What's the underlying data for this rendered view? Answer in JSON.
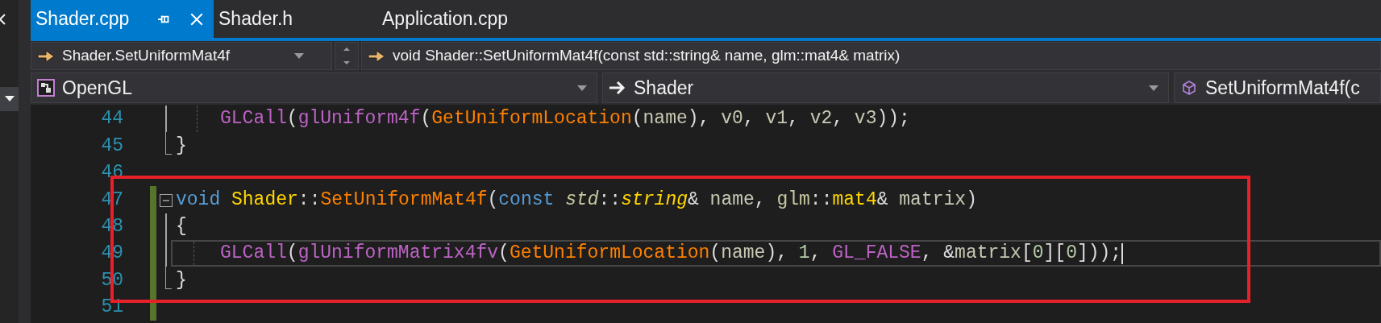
{
  "tabs": [
    {
      "label": "Shader.cpp",
      "selected": true
    },
    {
      "label": "Shader.h",
      "selected": false
    },
    {
      "label": "Application.cpp",
      "selected": false
    }
  ],
  "navigation_bar": {
    "member": "Shader.SetUniformMat4f",
    "signature": "void Shader::SetUniformMat4f(const std::string& name, glm::mat4& matrix)"
  },
  "scope_bar": {
    "project": "OpenGL",
    "class": "Shader",
    "member": "SetUniformMat4f(c"
  },
  "editor": {
    "lines": [
      {
        "number": "44",
        "changed": false,
        "fold_line": true,
        "fold_end": false,
        "fold_button": false,
        "indented": true,
        "current": false,
        "tokens": [
          {
            "text": "GLCall",
            "kind": "macro"
          },
          {
            "text": "(",
            "kind": "plain"
          },
          {
            "text": "glUniform4f",
            "kind": "macro"
          },
          {
            "text": "(",
            "kind": "plain"
          },
          {
            "text": "GetUniformLocation",
            "kind": "function"
          },
          {
            "text": "(",
            "kind": "plain"
          },
          {
            "text": "name",
            "kind": "parameter"
          },
          {
            "text": "), ",
            "kind": "plain"
          },
          {
            "text": "v0",
            "kind": "parameter"
          },
          {
            "text": ", ",
            "kind": "plain"
          },
          {
            "text": "v1",
            "kind": "parameter"
          },
          {
            "text": ", ",
            "kind": "plain"
          },
          {
            "text": "v2",
            "kind": "parameter"
          },
          {
            "text": ", ",
            "kind": "plain"
          },
          {
            "text": "v3",
            "kind": "parameter"
          },
          {
            "text": "));",
            "kind": "plain"
          }
        ]
      },
      {
        "number": "45",
        "changed": false,
        "fold_line": false,
        "fold_end": true,
        "fold_button": false,
        "indented": false,
        "current": false,
        "tokens": [
          {
            "text": "}",
            "kind": "plain"
          }
        ]
      },
      {
        "number": "46",
        "changed": false,
        "fold_line": false,
        "fold_end": false,
        "fold_button": false,
        "indented": false,
        "current": false
      },
      {
        "number": "47",
        "changed": true,
        "fold_line": false,
        "fold_end": false,
        "fold_button": true,
        "indented": false,
        "current": false,
        "tokens": [
          {
            "text": "void ",
            "kind": "keyword"
          },
          {
            "text": "Shader",
            "kind": "class"
          },
          {
            "text": "::",
            "kind": "plain"
          },
          {
            "text": "SetUniformMat4f",
            "kind": "function"
          },
          {
            "text": "(",
            "kind": "plain"
          },
          {
            "text": "const ",
            "kind": "keyword"
          },
          {
            "text": "std",
            "kind": "namespace_italic"
          },
          {
            "text": "::",
            "kind": "plain"
          },
          {
            "text": "string",
            "kind": "class_italic"
          },
          {
            "text": "& ",
            "kind": "plain"
          },
          {
            "text": "name",
            "kind": "parameter"
          },
          {
            "text": ", ",
            "kind": "plain"
          },
          {
            "text": "glm",
            "kind": "namespace"
          },
          {
            "text": "::",
            "kind": "plain"
          },
          {
            "text": "mat4",
            "kind": "class"
          },
          {
            "text": "& ",
            "kind": "plain"
          },
          {
            "text": "matrix",
            "kind": "parameter"
          },
          {
            "text": ")",
            "kind": "plain"
          }
        ]
      },
      {
        "number": "48",
        "changed": true,
        "fold_line": true,
        "fold_end": false,
        "fold_button": false,
        "indented": false,
        "current": false,
        "tokens": [
          {
            "text": "{",
            "kind": "plain"
          }
        ]
      },
      {
        "number": "49",
        "changed": true,
        "fold_line": true,
        "fold_end": false,
        "fold_button": false,
        "indented": true,
        "current": true,
        "tokens": [
          {
            "text": "GLCall",
            "kind": "macro"
          },
          {
            "text": "(",
            "kind": "plain"
          },
          {
            "text": "glUniformMatrix4fv",
            "kind": "macro"
          },
          {
            "text": "(",
            "kind": "plain"
          },
          {
            "text": "GetUniformLocation",
            "kind": "function"
          },
          {
            "text": "(",
            "kind": "plain"
          },
          {
            "text": "name",
            "kind": "parameter"
          },
          {
            "text": "), ",
            "kind": "plain"
          },
          {
            "text": "1",
            "kind": "number"
          },
          {
            "text": ", ",
            "kind": "plain"
          },
          {
            "text": "GL_FALSE",
            "kind": "macro"
          },
          {
            "text": ", &",
            "kind": "plain"
          },
          {
            "text": "matrix",
            "kind": "parameter"
          },
          {
            "text": "[",
            "kind": "plain"
          },
          {
            "text": "0",
            "kind": "number"
          },
          {
            "text": "][",
            "kind": "plain"
          },
          {
            "text": "0",
            "kind": "number"
          },
          {
            "text": "]));",
            "kind": "plain"
          }
        ]
      },
      {
        "number": "50",
        "changed": true,
        "fold_line": false,
        "fold_end": true,
        "fold_button": false,
        "indented": false,
        "current": false,
        "tokens": [
          {
            "text": "}",
            "kind": "plain"
          }
        ]
      },
      {
        "number": "51",
        "changed": true,
        "fold_line": false,
        "fold_end": false,
        "fold_button": false,
        "indented": false,
        "current": false
      }
    ]
  },
  "annotation": {
    "kind": "rectangle"
  }
}
